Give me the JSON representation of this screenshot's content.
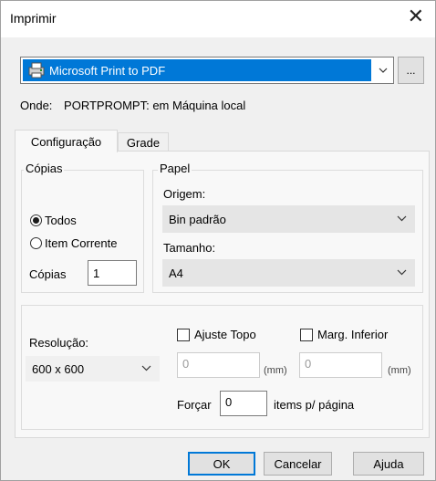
{
  "window": {
    "title": "Imprimir"
  },
  "printer": {
    "selected": "Microsoft Print to PDF",
    "ellipsis_label": "...",
    "location_label": "Onde:",
    "location_value": "PORTPROMPT: em Máquina local"
  },
  "tabs": [
    {
      "label": "Configuração",
      "active": true
    },
    {
      "label": "Grade",
      "active": false
    }
  ],
  "copies": {
    "group_label": "Cópias",
    "options": [
      {
        "label": "Todos",
        "checked": true
      },
      {
        "label": "Item Corrente",
        "checked": false
      }
    ],
    "count_label": "Cópias",
    "count_value": "1"
  },
  "paper": {
    "group_label": "Papel",
    "source_label": "Origem:",
    "source_value": "Bin padrão",
    "size_label": "Tamanho:",
    "size_value": "A4"
  },
  "options": {
    "resolution_label": "Resolução:",
    "resolution_value": "600 x 600",
    "top_adjust_label": "Ajuste Topo",
    "top_adjust_value": "0",
    "top_unit": "(mm)",
    "bottom_margin_label": "Marg. Inferior",
    "bottom_margin_value": "0",
    "bottom_unit": "(mm)",
    "force_label": "Forçar",
    "force_value": "0",
    "items_label": "items p/ página"
  },
  "buttons": {
    "ok": "OK",
    "cancel": "Cancelar",
    "help": "Ajuda"
  },
  "colors": {
    "selection": "#0078d7",
    "dialog_bg": "#f0f0f0",
    "default_button_border": "#0078d7"
  }
}
